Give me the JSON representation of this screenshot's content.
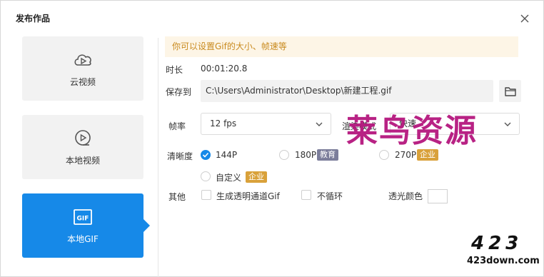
{
  "dialog": {
    "title": "发布作品"
  },
  "sidebar": {
    "items": [
      {
        "label": "云视频",
        "icon": "cloud-video-icon",
        "active": false
      },
      {
        "label": "本地视频",
        "icon": "local-video-icon",
        "active": false
      },
      {
        "label": "本地GIF",
        "icon": "gif-icon",
        "active": true
      }
    ]
  },
  "notice": "你可以设置Gif的大小、帧速等",
  "form": {
    "duration_label": "时长",
    "duration_value": "00:01:20.8",
    "saveto_label": "保存到",
    "saveto_path": "C:\\Users\\Administrator\\Desktop\\新建工程.gif",
    "framerate_label": "帧率",
    "framerate_value": "12 fps",
    "render_label": "渲染模式",
    "render_value": "快速",
    "clarity_label": "清晰度",
    "clarity_options": [
      {
        "label": "144P",
        "checked": true
      },
      {
        "label": "180P",
        "badge": "教育"
      },
      {
        "label": "270P",
        "badge": "企业"
      },
      {
        "label": "自定义",
        "badge": "企业"
      }
    ],
    "other_label": "其他",
    "transparent_label": "生成透明通道Gif",
    "noloop_label": "不循环",
    "transparent_color_label": "透光颜色"
  },
  "watermark": {
    "text": "莱鸟资源",
    "logo_number": "423",
    "logo_url": "423down.com"
  },
  "colors": {
    "accent": "#1689e8",
    "notice_bg": "#fdf5e6",
    "notice_text": "#c98a1e",
    "badge_edu": "#7b7d9a",
    "badge_ent": "#d9a13a",
    "watermark": "#b5177e"
  }
}
